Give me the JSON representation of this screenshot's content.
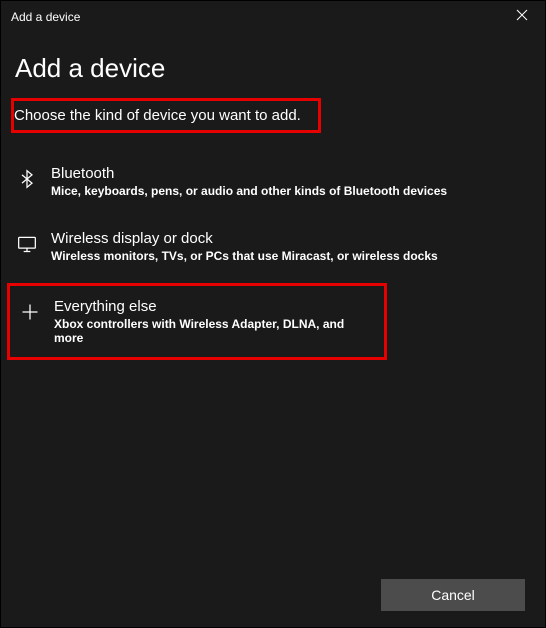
{
  "titlebar": {
    "title": "Add a device"
  },
  "page": {
    "heading": "Add a device",
    "subtitle": "Choose the kind of device you want to add."
  },
  "options": {
    "bluetooth": {
      "title": "Bluetooth",
      "desc": "Mice, keyboards, pens, or audio and other kinds of Bluetooth devices"
    },
    "wireless_display": {
      "title": "Wireless display or dock",
      "desc": "Wireless monitors, TVs, or PCs that use Miracast, or wireless docks"
    },
    "everything_else": {
      "title": "Everything else",
      "desc": "Xbox controllers with Wireless Adapter, DLNA, and more"
    }
  },
  "footer": {
    "cancel_label": "Cancel"
  }
}
